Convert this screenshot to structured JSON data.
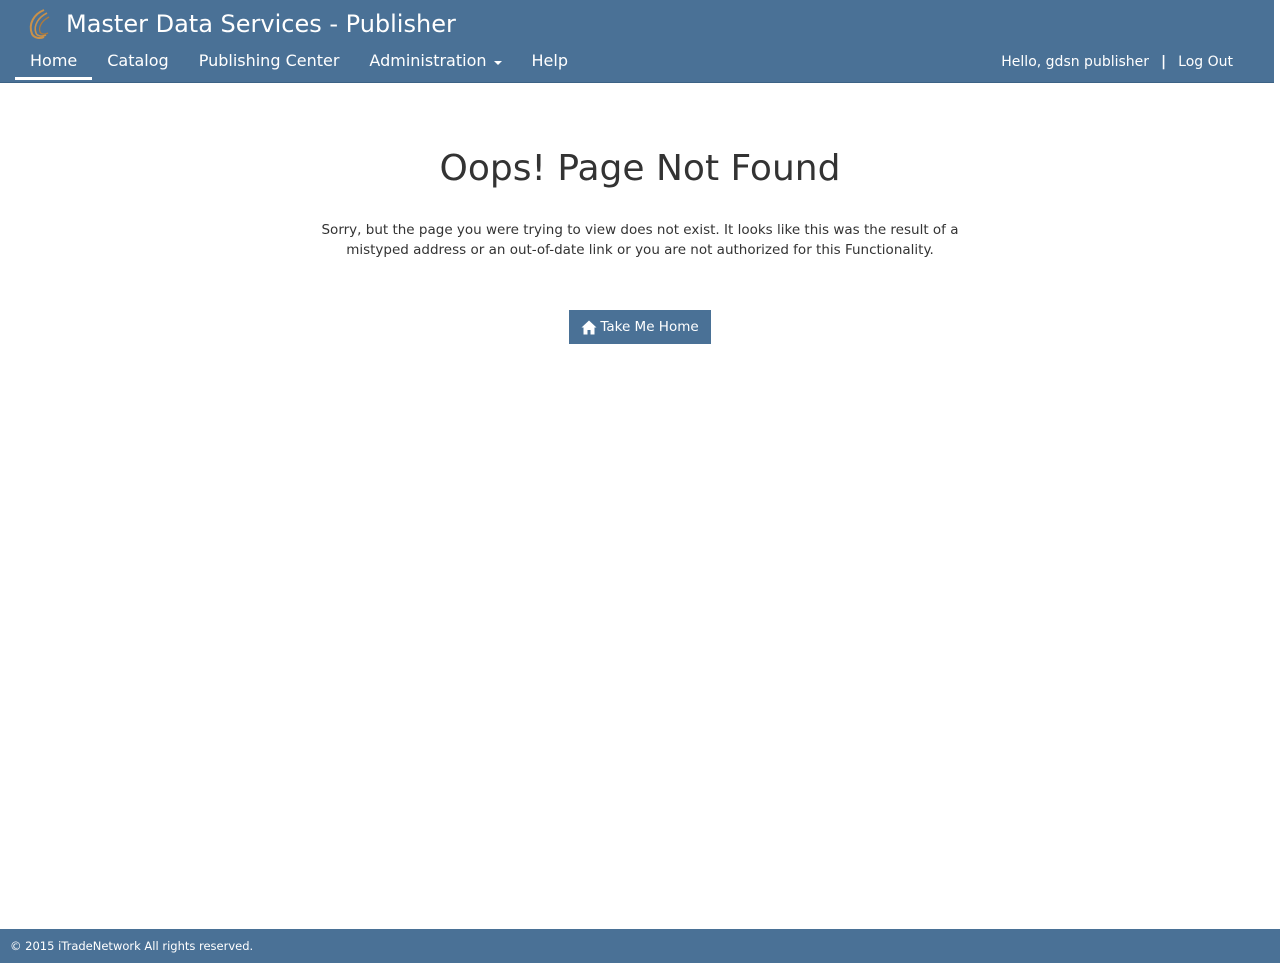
{
  "header": {
    "brand_title": "Master Data Services - Publisher",
    "logo_icon": "swirl-logo-icon",
    "colors": {
      "bar": "#4a7196",
      "logo_gold": "#c9914a"
    }
  },
  "nav": {
    "items": [
      {
        "label": "Home",
        "active": true
      },
      {
        "label": "Catalog",
        "active": false
      },
      {
        "label": "Publishing Center",
        "active": false
      },
      {
        "label": "Administration",
        "active": false,
        "has_dropdown": true
      },
      {
        "label": "Help",
        "active": false
      }
    ]
  },
  "user": {
    "greeting": "Hello, gdsn publisher",
    "separator": "|",
    "logout_label": "Log Out"
  },
  "main": {
    "title": "Oops! Page Not Found",
    "message": "Sorry, but the page you were trying to view does not exist. It looks like this was the result of a mistyped address or an out-of-date link or you are not authorized for this Functionality.",
    "home_button": {
      "label": "Take Me Home",
      "icon": "home-icon"
    }
  },
  "footer": {
    "copyright": "© 2015 iTradeNetwork All rights reserved."
  }
}
